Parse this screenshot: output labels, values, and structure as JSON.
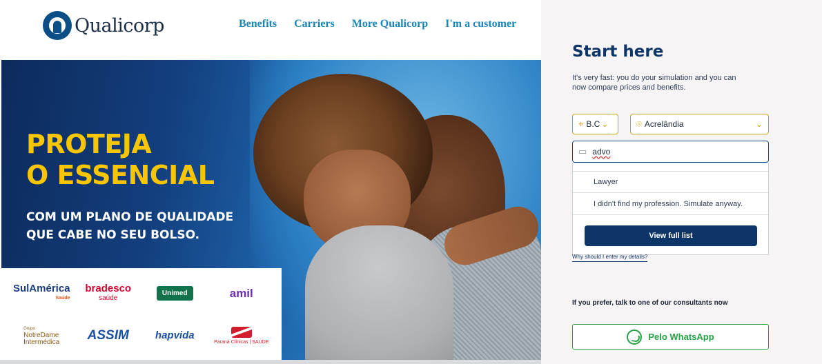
{
  "header": {
    "brand": "Qualicorp",
    "nav": [
      "Benefits",
      "Carriers",
      "More Qualicorp",
      "I'm a customer"
    ]
  },
  "hero": {
    "headline_line1": "PROTEJA",
    "headline_line2": "O ESSENCIAL",
    "sub_line1": "COM UM PLANO DE QUALIDADE",
    "sub_line2": "QUE CABE NO SEU BOLSO.",
    "carriers": {
      "sulamerica": "SulAmérica",
      "sulamerica_sub": "Saúde",
      "bradesco": "bradesco",
      "bradesco_sub": "saúde",
      "unimed": "Unimed",
      "amil": "amil",
      "notredame_top": "Grupo",
      "notredame": "NotreDame",
      "notredame_sub": "Intermédica",
      "assim": "ASSIM",
      "hapvida": "hapvida",
      "parana": "Paraná Clínicas | SAÚDE"
    }
  },
  "panel": {
    "title": "Start here",
    "description": "It's very fast: you do your simulation and you can now compare prices and benefits.",
    "state_value": "B.C",
    "city_value": "Acrelândia",
    "profession_value": "advo",
    "options": [
      "Lawyer",
      "I didn't find my profession. Simulate anyway."
    ],
    "view_full_list": "View full list",
    "why_link": "Why should I enter my details?",
    "prefer_text": "If you prefer, talk to one of our consultants now",
    "whatsapp_label": "Pelo WhatsApp"
  },
  "colors": {
    "brand_navy": "#0e3567",
    "nav_link": "#1a86b5",
    "accent_yellow": "#f7c600",
    "whatsapp_green": "#25a244"
  }
}
